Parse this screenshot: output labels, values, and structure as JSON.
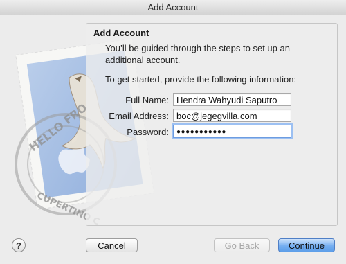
{
  "window": {
    "title": "Add Account"
  },
  "stamp": {
    "postmark_top": "HELLO FRO",
    "postmark_bottom": "CUPERTINO C"
  },
  "panel": {
    "title": "Add Account",
    "intro": "You’ll be guided through the steps to set up an additional account.",
    "intro2": "To get started, provide the following information:"
  },
  "form": {
    "full_name": {
      "label": "Full Name:",
      "value": "Hendra Wahyudi Saputro"
    },
    "email": {
      "label": "Email Address:",
      "value": "boc@jegegvilla.com"
    },
    "password": {
      "label": "Password:",
      "value": "●●●●●●●●●●●"
    }
  },
  "buttons": {
    "help": "?",
    "cancel": "Cancel",
    "go_back": "Go Back",
    "continue": "Continue"
  }
}
